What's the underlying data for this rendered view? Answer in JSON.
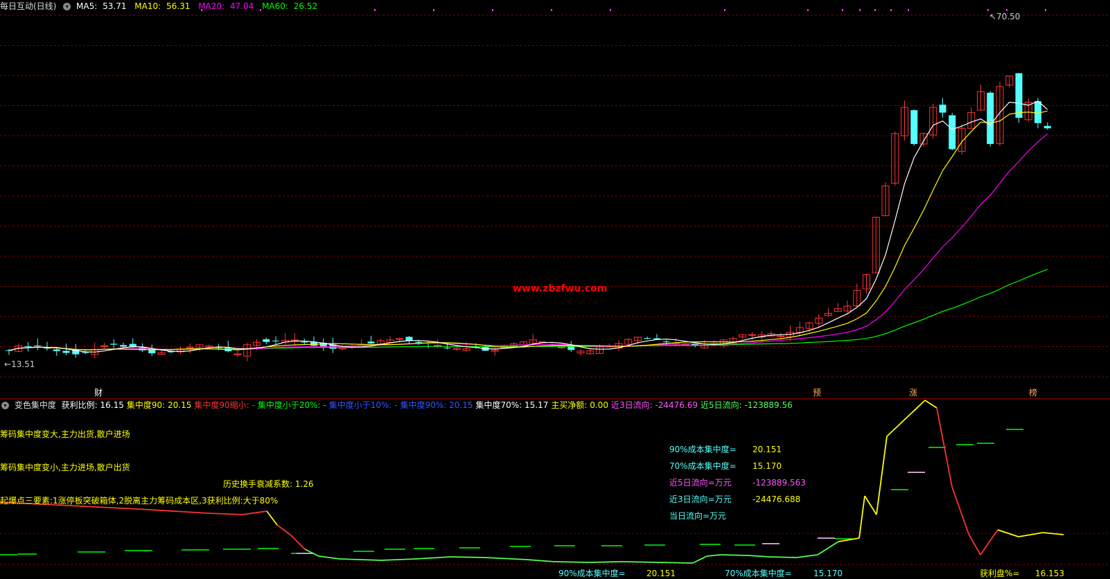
{
  "colors": {
    "up": "#ff3333",
    "down": "#55ffff",
    "ma5": "#ffffff",
    "ma10": "#ffff00",
    "ma20": "#ff00ff",
    "ma60": "#00ff00",
    "grid": "#800000",
    "watermark": "#ff0000"
  },
  "header": {
    "title": "每日互动(日线)",
    "ma5_label": "MA5:",
    "ma5_value": "53.71",
    "ma10_label": "MA10:",
    "ma10_value": "56.31",
    "ma20_label": "MA20:",
    "ma20_value": "47.04",
    "ma60_label": "MA60:",
    "ma60_value": "26.52"
  },
  "price_chart": {
    "high_label": "70.50",
    "low_label": "13.51",
    "watermark": "www.zbzfwu.com",
    "event_markers": [
      "财",
      "预",
      "涨",
      "榜"
    ]
  },
  "indicator": {
    "name": "变色集中度",
    "items": [
      {
        "label": "获利比例:",
        "value": "16.15",
        "color": "#ffffff"
      },
      {
        "label": "集中度90:",
        "value": "20.15",
        "color": "#ffff00"
      },
      {
        "label": "集中度90缩小:",
        "value": "-",
        "color": "#ff3333"
      },
      {
        "label": "集中度小于20%:",
        "value": "-",
        "color": "#00ff00"
      },
      {
        "label": "集中度小于10%:",
        "value": "-",
        "color": "#3355ff"
      },
      {
        "label": "集中度90%:",
        "value": "20.15",
        "color": "#3355ff"
      },
      {
        "label": "集中度70%:",
        "value": "15.17",
        "color": "#ffffff"
      },
      {
        "label": "主买净额:",
        "value": "0.00",
        "color": "#ffff00"
      },
      {
        "label": "近3日流向:",
        "value": "-24476.69",
        "color": "#ff55ff"
      },
      {
        "label": "近5日流向:",
        "value": "-123889.56",
        "color": "#55ff55"
      }
    ],
    "text_left_1": "筹码集中度变大,主力出货,散户进场",
    "text_left_2": "筹码集中度变小,主力进场,散户出货",
    "decay_label": "历史换手衰减系数:",
    "decay_value": "1.26",
    "elements_text": "起爆点三要素:1涨停板突破箱体,2脱离主力筹码成本区,3获利比例:大于80%",
    "stats": [
      {
        "label": "90%成本集中度=",
        "value": "20.151"
      },
      {
        "label": "70%成本集中度=",
        "value": "15.170"
      },
      {
        "label": "近5日流向=万元",
        "value": "-123889.563"
      },
      {
        "label": "近3日流向=万元",
        "value": "-24476.688"
      },
      {
        "label": "当日流向=万元",
        "value": ""
      }
    ],
    "bottom_90_label": "90%成本集中度=",
    "bottom_90_value": "20.151",
    "bottom_70_label": "70%成本集中度=",
    "bottom_70_value": "15.170",
    "profit_label": "获利盘%=",
    "profit_value": "16.153"
  }
}
